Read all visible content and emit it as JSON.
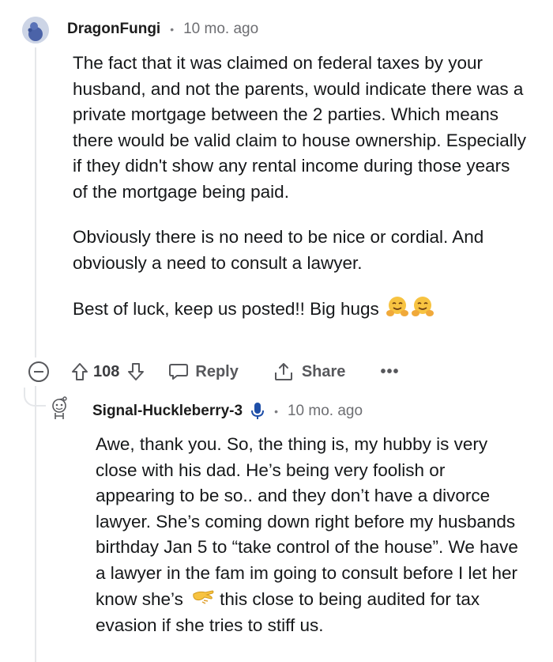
{
  "parent_comment": {
    "author": "DragonFungi",
    "separator": "•",
    "time": "10 mo. ago",
    "paragraphs": [
      "The fact that it was claimed on federal taxes by your husband, and not the parents, would indicate there was a private mortgage between the 2 parties. Which means there would be valid claim to house ownership. Especially if they didn't show any rental income during those years of the mortgage being paid.",
      "Obviously there is no need to be nice or cordial. And obviously a need to consult a lawyer."
    ],
    "closing": "Best of luck, keep us posted!! Big hugs",
    "closing_emoji": "hugging-face-icon x2",
    "actions": {
      "score": "108",
      "reply_label": "Reply",
      "share_label": "Share",
      "more_label": "•••"
    }
  },
  "reply_comment": {
    "author": "Signal-Huckleberry-3",
    "separator": "•",
    "time": "10 mo. ago",
    "text_before_emoji": "Awe, thank you. So, the thing is, my hubby is very close with his dad. He’s being very foolish or appearing to be so.. and they don’t have a divorce lawyer. She’s coming down right before my husbands birthday Jan 5 to “take control of the house”. We have a lawyer in the fam im going to consult before I let her know she’s",
    "inline_emoji": "pinching-hand-icon",
    "text_after_emoji": "this close to being audited for tax evasion if she tries to stiff us."
  },
  "colors": {
    "thread_line": "#e5e7ea",
    "meta_gray": "#6d6e72",
    "action_gray": "#57585c",
    "mic_blue": "#1f4fa8"
  }
}
